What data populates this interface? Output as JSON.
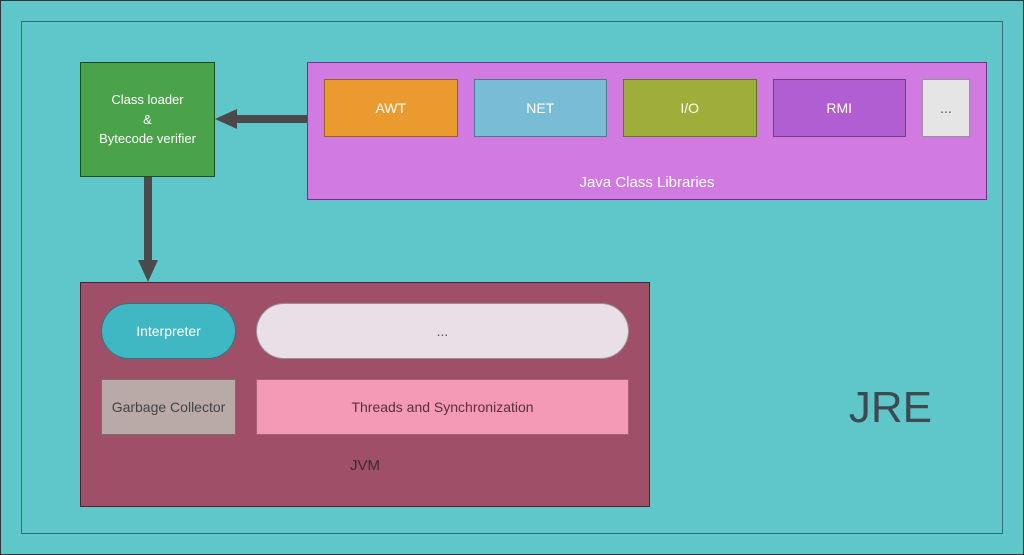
{
  "outer_label": "JRE",
  "classloader": {
    "line1": "Class loader",
    "line2": "&",
    "line3": "Bytecode verifier"
  },
  "jcl": {
    "title": "Java Class Libraries",
    "libs": [
      {
        "label": "AWT",
        "bg": "#ea9a2e"
      },
      {
        "label": "NET",
        "bg": "#79bcd6"
      },
      {
        "label": "I/O",
        "bg": "#9fae3a"
      },
      {
        "label": "RMI",
        "bg": "#b15ed2"
      }
    ],
    "more": "..."
  },
  "jvm": {
    "title": "JVM",
    "interpreter": "Interpreter",
    "more": "...",
    "gc": "Garbage Collector",
    "threads": "Threads and Synchronization"
  },
  "colors": {
    "arrow": "#4a4a4a"
  }
}
